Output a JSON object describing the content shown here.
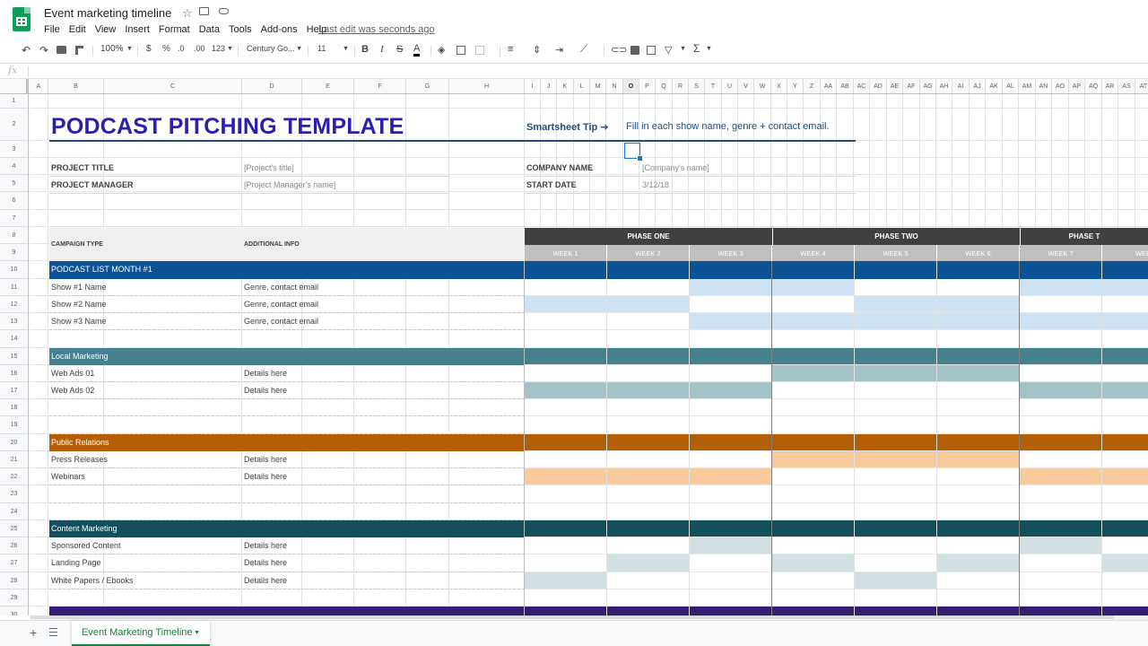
{
  "app": {
    "doc_title": "Event marketing timeline",
    "menu": [
      "File",
      "Edit",
      "View",
      "Insert",
      "Format",
      "Data",
      "Tools",
      "Add-ons",
      "Help"
    ],
    "last_edit": "Last edit was seconds ago"
  },
  "toolbar": {
    "zoom": "100%",
    "currency": "$",
    "percent": "%",
    "decrease_decimal": ".0",
    "increase_decimal": ".00",
    "more_formats": "123",
    "font": "Century Go...",
    "font_size": "11",
    "bold": "B",
    "italic": "I",
    "strike": "S",
    "text_color": "A",
    "sum": "Σ"
  },
  "formula_bar": {
    "fx": "fx"
  },
  "columns": [
    "A",
    "B",
    "C",
    "D",
    "E",
    "F",
    "G",
    "H",
    "I",
    "J",
    "K",
    "L",
    "M",
    "N",
    "O",
    "P",
    "Q",
    "R",
    "S",
    "T",
    "U",
    "V",
    "W",
    "X",
    "Y",
    "Z",
    "AA",
    "AB",
    "AC",
    "AD",
    "AE",
    "AF",
    "AG",
    "AH",
    "AI",
    "AJ",
    "AK",
    "AL",
    "AM",
    "AN",
    "AO",
    "AP",
    "AQ",
    "AR",
    "AS",
    "AT"
  ],
  "active_column": "O",
  "rows": [
    "1",
    "2",
    "3",
    "4",
    "5",
    "6",
    "7",
    "8",
    "9",
    "10",
    "11",
    "12",
    "13",
    "14",
    "15",
    "16",
    "17",
    "18",
    "19",
    "20",
    "21",
    "22",
    "23",
    "24",
    "25",
    "26",
    "27",
    "28",
    "29",
    "30"
  ],
  "sheet": {
    "title": "PODCAST PITCHING TEMPLATE",
    "tip_label": "Smartsheet Tip ➜",
    "tip_text": "Fill in each show name, genre + contact email.",
    "project_title_label": "PROJECT TITLE",
    "project_title_value": "[Project's title]",
    "project_manager_label": "PROJECT MANAGER",
    "project_manager_value": "[Project Manager's name]",
    "company_name_label": "COMPANY NAME",
    "company_name_value": "[Company's name]",
    "start_date_label": "START DATE",
    "start_date_value": "3/12/18",
    "campaign_type_label": "CAMPAIGN TYPE",
    "additional_info_label": "ADDITIONAL INFO",
    "phases": [
      "PHASE ONE",
      "PHASE TWO",
      "PHASE T"
    ],
    "weeks": [
      "WEEK 1",
      "WEEK 2",
      "WEEK 3",
      "WEEK 4",
      "WEEK 5",
      "WEEK 6",
      "WEEK 7",
      "WEE"
    ]
  },
  "sections": [
    {
      "label": "PODCAST LIST MONTH #1",
      "color": "#0b5394",
      "fill": "#cfe2f3",
      "items": [
        {
          "name": "Show #1 Name",
          "info": "Genre, contact email",
          "weeks": [
            0,
            0,
            1,
            1,
            0,
            0,
            1,
            1
          ]
        },
        {
          "name": "Show #2 Name",
          "info": "Genre, contact email",
          "weeks": [
            1,
            1,
            0,
            0,
            1,
            1,
            0,
            0
          ]
        },
        {
          "name": "Show #3 Name",
          "info": "Genre, contact email",
          "weeks": [
            0,
            0,
            1,
            1,
            1,
            1,
            1,
            1
          ]
        }
      ]
    },
    {
      "label": "Local Marketing",
      "color": "#45818e",
      "fill": "#a2c4c9",
      "items": [
        {
          "name": "Web Ads 01",
          "info": "Details here",
          "weeks": [
            0,
            0,
            0,
            1,
            1,
            1,
            0,
            0
          ]
        },
        {
          "name": "Web Ads 02",
          "info": "Details here",
          "weeks": [
            1,
            1,
            1,
            0,
            0,
            0,
            1,
            1
          ]
        }
      ]
    },
    {
      "label": "Public Relations",
      "color": "#b45f06",
      "fill": "#f9cb9c",
      "items": [
        {
          "name": "Press Releases",
          "info": "Details here",
          "weeks": [
            0,
            0,
            0,
            1,
            1,
            1,
            0,
            0
          ]
        },
        {
          "name": "Webinars",
          "info": "Details here",
          "weeks": [
            1,
            1,
            1,
            0,
            0,
            0,
            1,
            1
          ]
        }
      ]
    },
    {
      "label": "Content Marketing",
      "color": "#134f5c",
      "fill": "#d0e0e3",
      "items": [
        {
          "name": "Sponsored Content",
          "info": "Details here",
          "weeks": [
            0,
            0,
            1,
            0,
            0,
            0,
            1,
            0
          ]
        },
        {
          "name": "Landing Page",
          "info": "Details here",
          "weeks": [
            0,
            1,
            0,
            1,
            0,
            1,
            0,
            1
          ]
        },
        {
          "name": "White Papers / Ebooks",
          "info": "Details here",
          "weeks": [
            1,
            0,
            0,
            0,
            1,
            0,
            0,
            0
          ]
        }
      ]
    }
  ],
  "next_section_color": "#351c75",
  "sheet_tabs": [
    {
      "label": "Event Marketing Timeline",
      "active": true
    }
  ],
  "colors": {
    "accent_green": "#188038",
    "title_blue": "#2a1faf",
    "header_dark": "#404040",
    "header_gray": "#bfbfbf"
  }
}
